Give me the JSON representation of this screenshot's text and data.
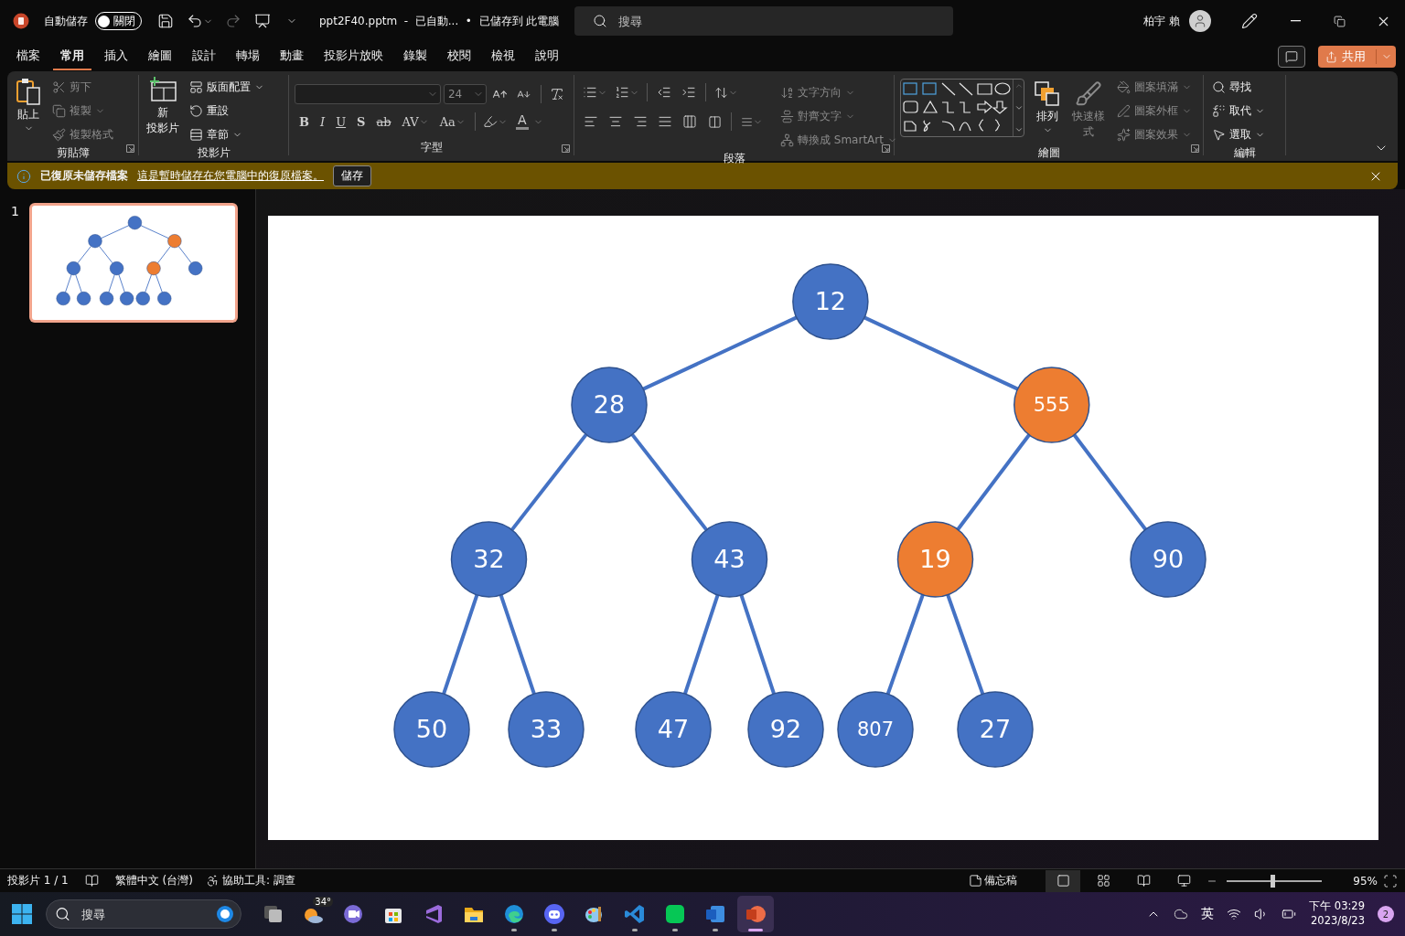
{
  "title_bar": {
    "autosave_label": "自動儲存",
    "autosave": {
      "on": false,
      "label": "關閉"
    },
    "file_title": "ppt2F40.pptm  -  已自動...  •  已儲存到 此電腦",
    "search": {
      "placeholder": "搜尋"
    },
    "user_name": "柏宇 賴"
  },
  "menu_tabs": [
    {
      "label": "檔案",
      "selected": false
    },
    {
      "label": "常用",
      "selected": true
    },
    {
      "label": "插入",
      "selected": false
    },
    {
      "label": "繪圖",
      "selected": false
    },
    {
      "label": "設計",
      "selected": false
    },
    {
      "label": "轉場",
      "selected": false
    },
    {
      "label": "動畫",
      "selected": false
    },
    {
      "label": "投影片放映",
      "selected": false
    },
    {
      "label": "錄製",
      "selected": false
    },
    {
      "label": "校閱",
      "selected": false
    },
    {
      "label": "檢視",
      "selected": false
    },
    {
      "label": "說明",
      "selected": false
    }
  ],
  "share_button": "共用",
  "ribbon": {
    "clipboard": {
      "label": "剪貼簿",
      "items": [
        {
          "label": "貼上",
          "disabled": false
        },
        {
          "label": "剪下",
          "disabled": true
        },
        {
          "label": "複製",
          "disabled": true
        },
        {
          "label": "複製格式",
          "disabled": true
        }
      ]
    },
    "slides": {
      "label": "投影片",
      "items": [
        {
          "lines": [
            "新",
            "投影片"
          ],
          "disabled": false
        },
        {
          "label": "版面配置",
          "disabled": false
        },
        {
          "label": "重設",
          "disabled": false
        },
        {
          "label": "章節",
          "disabled": false
        }
      ]
    },
    "font": {
      "label": "字型",
      "font_size": "24",
      "format_buttons": [
        "B",
        "I",
        "U",
        "S",
        "ab",
        "AV",
        "Aa"
      ],
      "font_color_glyph": "A"
    },
    "paragraph": {
      "label": "段落",
      "items": [
        {
          "label": "文字方向",
          "disabled": true
        },
        {
          "label": "對齊文字",
          "disabled": true
        },
        {
          "label": "轉換成 SmartArt",
          "disabled": true
        }
      ]
    },
    "drawing": {
      "label": "繪圖",
      "items": [
        {
          "label": "排列",
          "disabled": false
        },
        {
          "lines": [
            "快速樣",
            "式"
          ],
          "disabled": true
        },
        {
          "label": "圖案填滿",
          "disabled": true
        },
        {
          "label": "圖案外框",
          "disabled": true
        },
        {
          "label": "圖案效果",
          "disabled": true
        }
      ]
    },
    "editing": {
      "label": "編輯",
      "items": [
        {
          "label": "尋找",
          "disabled": false
        },
        {
          "label": "取代",
          "disabled": false
        },
        {
          "label": "選取",
          "disabled": false
        }
      ]
    }
  },
  "info_bar": {
    "title": "已復原未儲存檔案",
    "link": "這是暫時儲存在您電腦中的復原檔案。",
    "button": "儲存"
  },
  "slides": [
    {
      "number": "1",
      "selected": true
    }
  ],
  "tree": {
    "label": "12",
    "color": "#4472c4",
    "children": [
      {
        "label": "28",
        "color": "#4472c4",
        "children": [
          {
            "label": "32",
            "color": "#4472c4",
            "children": [
              {
                "label": "50",
                "color": "#4472c4"
              },
              {
                "label": "33",
                "color": "#4472c4"
              }
            ]
          },
          {
            "label": "43",
            "color": "#4472c4",
            "children": [
              {
                "label": "47",
                "color": "#4472c4"
              },
              {
                "label": "92",
                "color": "#4472c4"
              }
            ]
          }
        ]
      },
      {
        "label": "555",
        "color": "#ed7d31",
        "children": [
          {
            "label": "19",
            "color": "#ed7d31",
            "children": [
              {
                "label": "807",
                "color": "#4472c4"
              },
              {
                "label": "27",
                "color": "#4472c4"
              }
            ]
          },
          {
            "label": "90",
            "color": "#4472c4"
          }
        ]
      }
    ]
  },
  "status_bar": {
    "slide_counter": "投影片 1 / 1",
    "language": "繁體中文 (台灣)",
    "accessibility": "協助工具: 調查",
    "notes": "備忘稿",
    "views": [
      {
        "selected": true
      },
      {
        "selected": false
      },
      {
        "selected": false
      },
      {
        "selected": false
      }
    ],
    "zoom": {
      "level": 0.48,
      "reading": "95%"
    }
  },
  "taskbar": {
    "search_placeholder": "搜尋",
    "weather": "34°",
    "apps": [
      {
        "kind": "taskview",
        "running": false,
        "selected": false
      },
      {
        "kind": "weather",
        "running": false,
        "selected": false
      },
      {
        "kind": "meet",
        "running": false,
        "selected": false
      },
      {
        "kind": "store",
        "running": false,
        "selected": false
      },
      {
        "kind": "vs",
        "running": false,
        "selected": false
      },
      {
        "kind": "folder",
        "running": false,
        "selected": false
      },
      {
        "kind": "edge",
        "running": true,
        "selected": false
      },
      {
        "kind": "discord",
        "running": true,
        "selected": false
      },
      {
        "kind": "paint",
        "running": false,
        "selected": false
      },
      {
        "kind": "vscode",
        "running": true,
        "selected": false
      },
      {
        "kind": "line",
        "running": true,
        "selected": false
      },
      {
        "kind": "word",
        "running": true,
        "selected": false
      },
      {
        "kind": "powerpoint",
        "running": true,
        "selected": true
      }
    ],
    "ime": "英",
    "time": "下午 03:29",
    "date": "2023/8/23",
    "notifications": "2"
  }
}
